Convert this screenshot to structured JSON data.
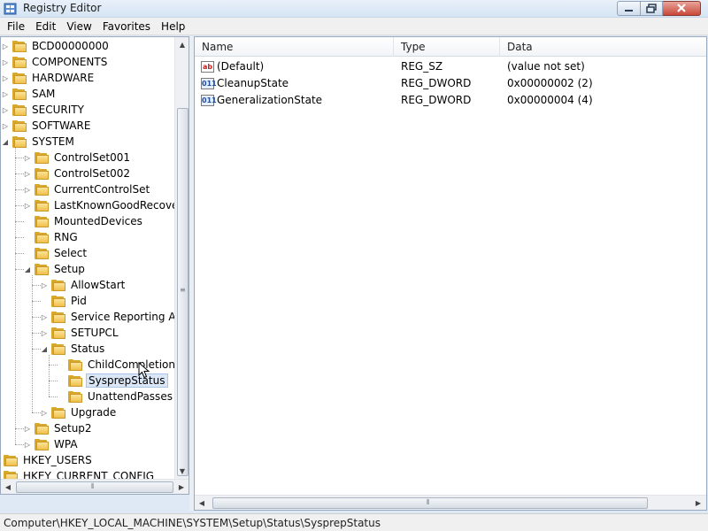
{
  "window": {
    "title": "Registry Editor"
  },
  "menu": [
    "File",
    "Edit",
    "View",
    "Favorites",
    "Help"
  ],
  "tree": [
    {
      "label": "BCD00000000",
      "level": 1,
      "expander": "collapsed"
    },
    {
      "label": "COMPONENTS",
      "level": 1,
      "expander": "collapsed"
    },
    {
      "label": "HARDWARE",
      "level": 1,
      "expander": "collapsed"
    },
    {
      "label": "SAM",
      "level": 1,
      "expander": "collapsed"
    },
    {
      "label": "SECURITY",
      "level": 1,
      "expander": "collapsed"
    },
    {
      "label": "SOFTWARE",
      "level": 1,
      "expander": "collapsed"
    },
    {
      "label": "SYSTEM",
      "level": 1,
      "expander": "expanded"
    },
    {
      "label": "ControlSet001",
      "level": 2,
      "expander": "collapsed"
    },
    {
      "label": "ControlSet002",
      "level": 2,
      "expander": "collapsed"
    },
    {
      "label": "CurrentControlSet",
      "level": 2,
      "expander": "collapsed"
    },
    {
      "label": "LastKnownGoodRecovery",
      "level": 2,
      "expander": "collapsed"
    },
    {
      "label": "MountedDevices",
      "level": 2,
      "expander": "none"
    },
    {
      "label": "RNG",
      "level": 2,
      "expander": "none"
    },
    {
      "label": "Select",
      "level": 2,
      "expander": "none"
    },
    {
      "label": "Setup",
      "level": 2,
      "expander": "expanded"
    },
    {
      "label": "AllowStart",
      "level": 3,
      "expander": "collapsed"
    },
    {
      "label": "Pid",
      "level": 3,
      "expander": "none"
    },
    {
      "label": "Service Reporting API",
      "level": 3,
      "expander": "collapsed"
    },
    {
      "label": "SETUPCL",
      "level": 3,
      "expander": "collapsed"
    },
    {
      "label": "Status",
      "level": 3,
      "expander": "expanded"
    },
    {
      "label": "ChildCompletion",
      "level": 4,
      "expander": "none"
    },
    {
      "label": "SysprepStatus",
      "level": 4,
      "expander": "none",
      "selected": true
    },
    {
      "label": "UnattendPasses",
      "level": 4,
      "expander": "none"
    },
    {
      "label": "Upgrade",
      "level": 3,
      "expander": "collapsed"
    },
    {
      "label": "Setup2",
      "level": 2,
      "expander": "collapsed"
    },
    {
      "label": "WPA",
      "level": 2,
      "expander": "collapsed"
    },
    {
      "label": "HKEY_USERS",
      "level": 0,
      "expander": "none"
    },
    {
      "label": "HKEY_CURRENT_CONFIG",
      "level": 0,
      "expander": "none"
    }
  ],
  "list": {
    "columns": [
      "Name",
      "Type",
      "Data"
    ],
    "rows": [
      {
        "icon": "string-value-icon",
        "icon_text": "ab",
        "name": "(Default)",
        "type": "REG_SZ",
        "data": "(value not set)"
      },
      {
        "icon": "dword-value-icon",
        "icon_text": "011",
        "name": "CleanupState",
        "type": "REG_DWORD",
        "data": "0x00000002 (2)"
      },
      {
        "icon": "dword-value-icon",
        "icon_text": "011",
        "name": "GeneralizationState",
        "type": "REG_DWORD",
        "data": "0x00000004 (4)"
      }
    ]
  },
  "status": {
    "path": "Computer\\HKEY_LOCAL_MACHINE\\SYSTEM\\Setup\\Status\\SysprepStatus"
  },
  "scrollbar_glyphs": {
    "grip_v": "≡",
    "grip_h": "⦀"
  },
  "colors": {
    "folder": "#f0c04a",
    "selection": "#dbe7f6",
    "titlebar": "#d6e4f3"
  }
}
